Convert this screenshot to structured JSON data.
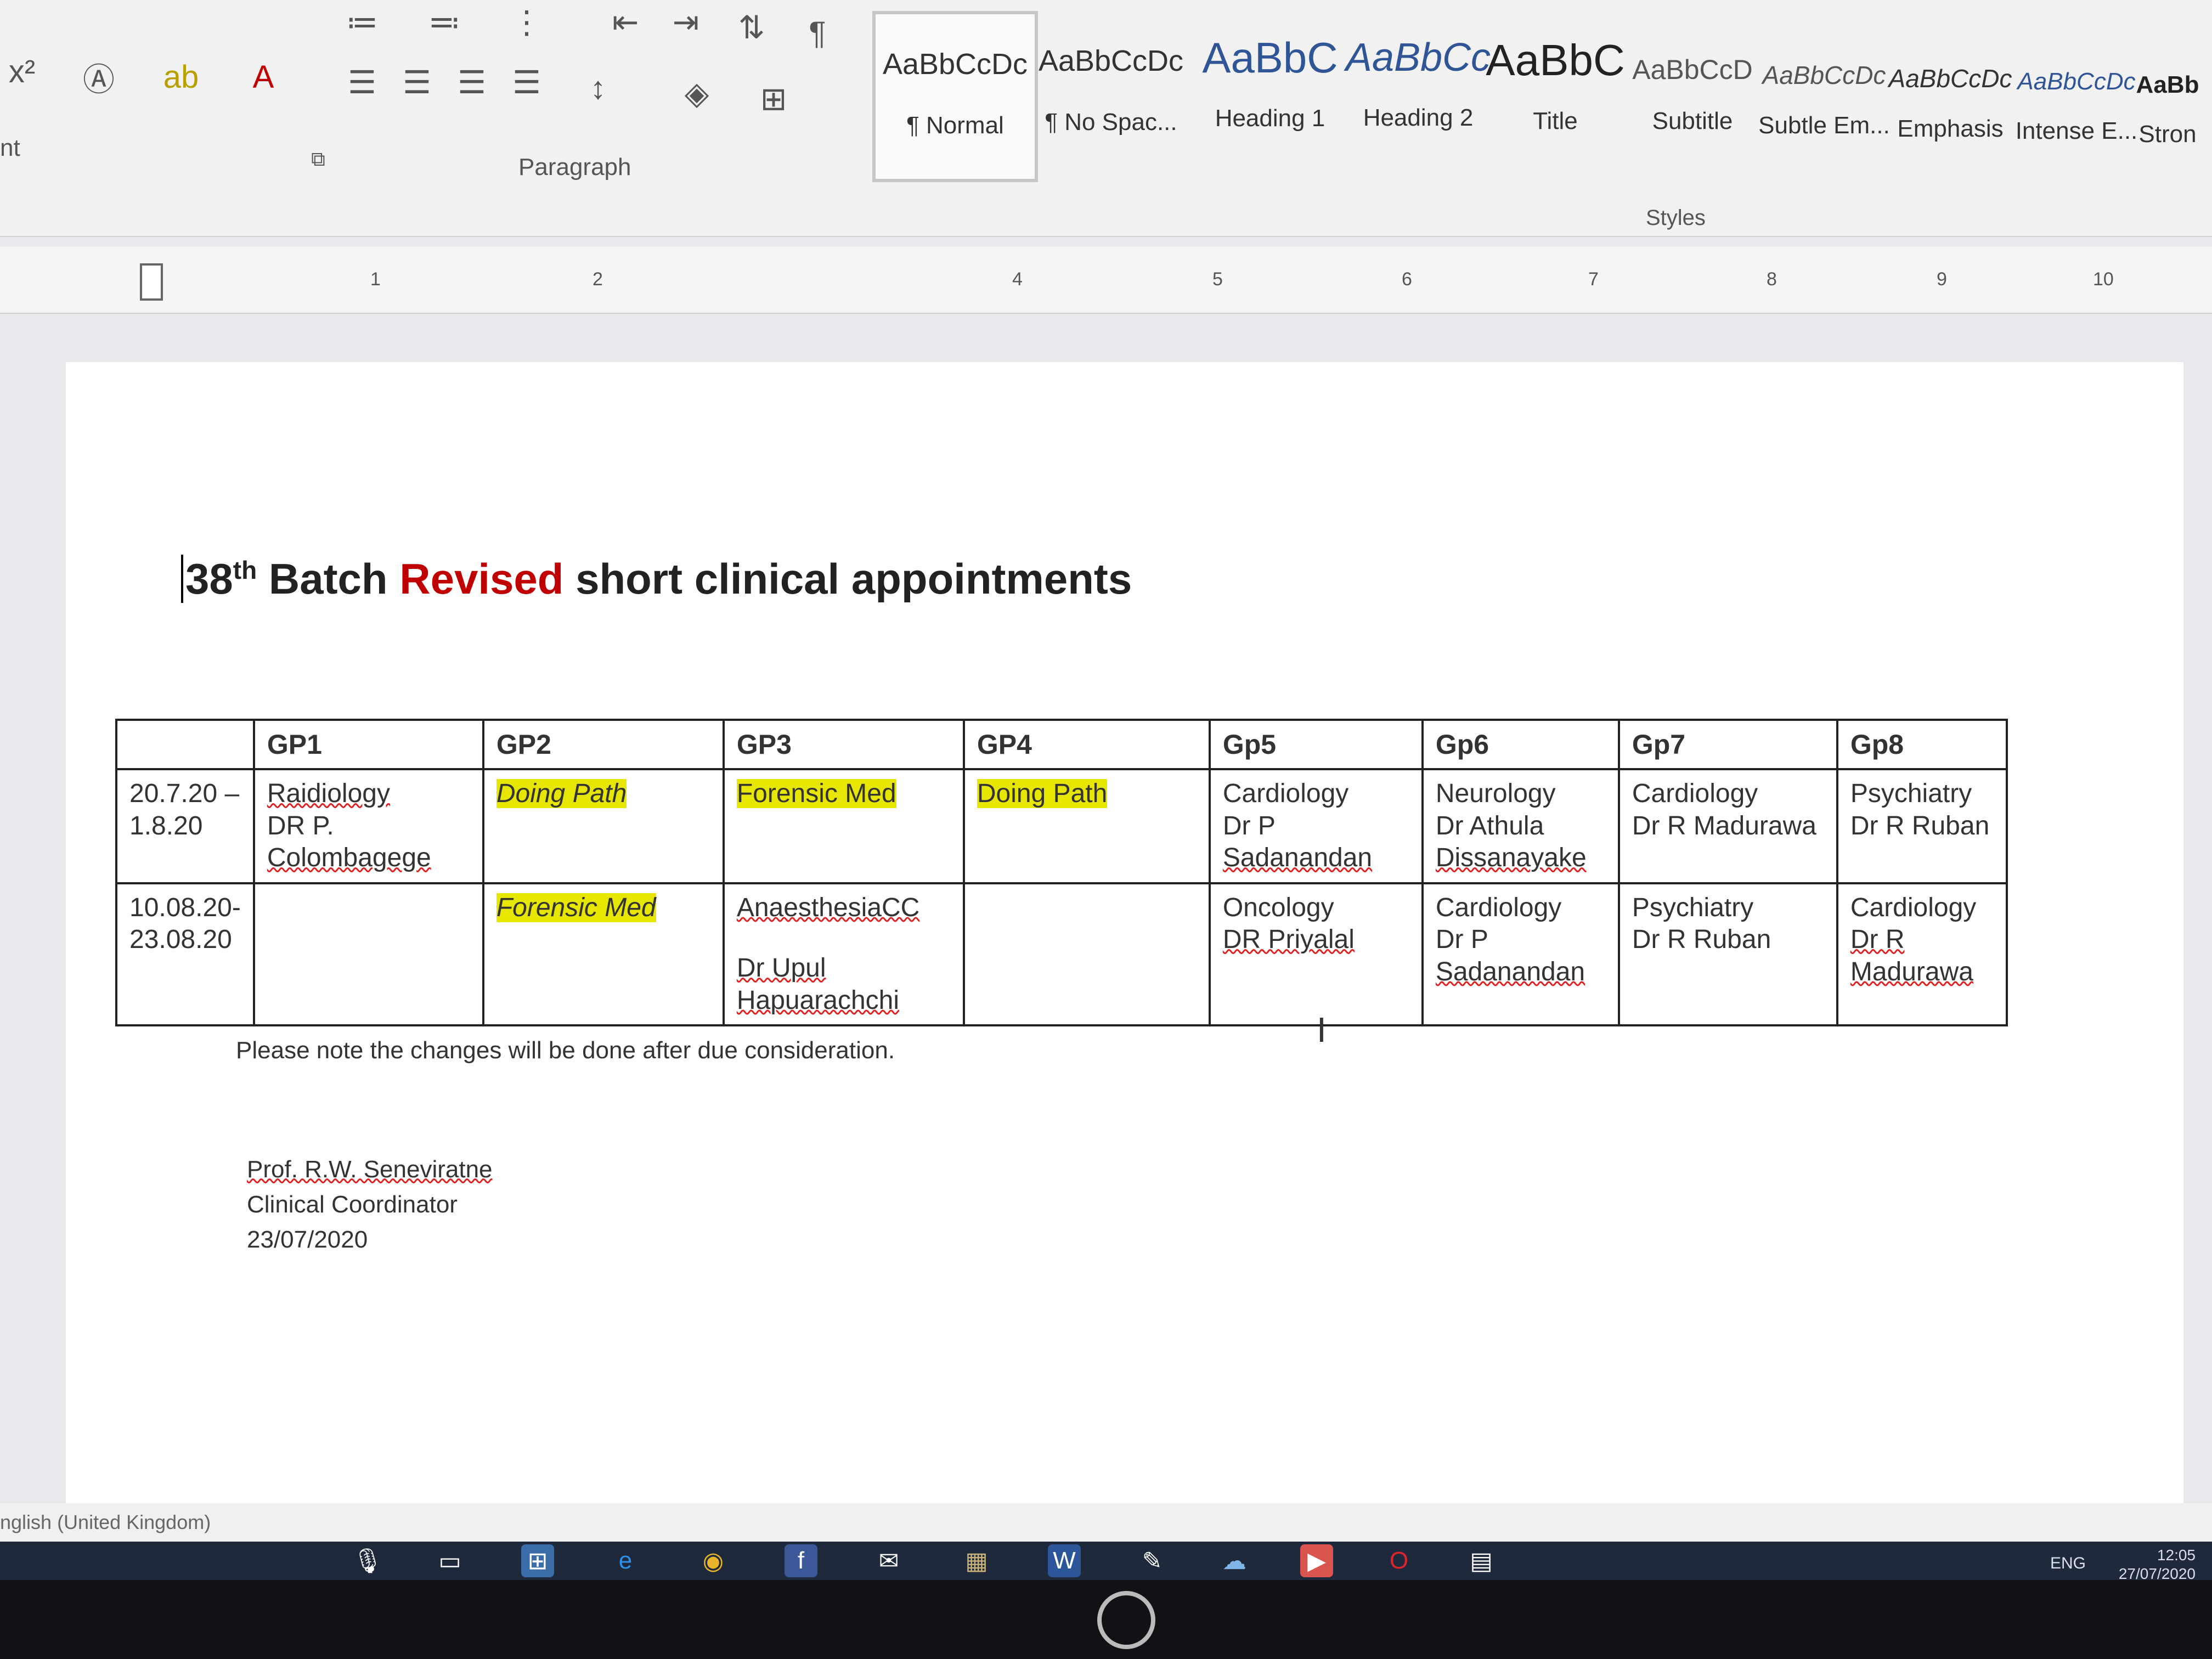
{
  "ribbon": {
    "font_group_label": "nt",
    "paragraph_group_label": "Paragraph",
    "styles_group_label": "Styles",
    "styles": [
      {
        "sample": "AaBbCcDc",
        "name": "¶ Normal"
      },
      {
        "sample": "AaBbCcDc",
        "name": "¶ No Spac..."
      },
      {
        "sample": "AaBbC",
        "name": "Heading 1"
      },
      {
        "sample": "AaBbCc",
        "name": "Heading 2"
      },
      {
        "sample": "AaBbC",
        "name": "Title"
      },
      {
        "sample": "AaBbCcD",
        "name": "Subtitle"
      },
      {
        "sample": "AaBbCcDc",
        "name": "Subtle Em..."
      },
      {
        "sample": "AaBbCcDc",
        "name": "Emphasis"
      },
      {
        "sample": "AaBbCcDc",
        "name": "Intense E..."
      },
      {
        "sample": "AaBb",
        "name": "Stron"
      }
    ],
    "icons": [
      "superscript-icon",
      "text-effects-icon",
      "highlight-icon",
      "font-color-icon",
      "align-left-icon",
      "center-icon",
      "align-right-icon",
      "justify-icon",
      "line-spacing-icon",
      "shading-icon",
      "borders-icon",
      "bullets-icon",
      "numbering-icon",
      "multilevel-list-icon",
      "decrease-indent-icon",
      "increase-indent-icon",
      "sort-icon",
      "show-marks-icon"
    ]
  },
  "ruler": {
    "numbers": [
      "1",
      "2",
      "4",
      "5",
      "6",
      "7",
      "8",
      "9",
      "10"
    ]
  },
  "document": {
    "title_prefix": "38",
    "title_sup": "th",
    "title_batch": " Batch ",
    "title_revised": "Revised",
    "title_rest": " short clinical appointments",
    "table": {
      "headers": [
        "",
        "GP1",
        "GP2",
        "GP3",
        "GP4",
        "Gp5",
        "Gp6",
        "Gp7",
        "Gp8"
      ],
      "rows": [
        {
          "date_line1": "20.7.20 –",
          "date_line2": "1.8.20",
          "gp1": {
            "line1": "Raidiology",
            "line2": "DR P.",
            "line3": "Colombagege"
          },
          "gp2": "Doing Path",
          "gp3": "Forensic Med",
          "gp4": "Doing Path",
          "gp5": {
            "line1": "Cardiology",
            "line2": "Dr P",
            "line3": "Sadanandan"
          },
          "gp6": {
            "line1": "Neurology",
            "line2": "Dr Athula",
            "line3": "Dissanayake"
          },
          "gp7": {
            "line1": "Cardiology",
            "line2": "Dr R Madurawa"
          },
          "gp8": {
            "line1": "Psychiatry",
            "line2": "Dr R Ruban"
          }
        },
        {
          "date_line1": "10.08.20-",
          "date_line2": "23.08.20",
          "gp1": "",
          "gp2": "Forensic Med",
          "gp3": {
            "line1": "AnaesthesiaCC",
            "line2": "",
            "line3": "Dr Upul",
            "line4": "Hapuarachchi"
          },
          "gp4": "",
          "gp5": {
            "line1": "Oncology",
            "line2": "DR  Priyalal"
          },
          "gp6": {
            "line1": "Cardiology",
            "line2": "Dr P",
            "line3": "Sadanandan"
          },
          "gp7": {
            "line1": "Psychiatry",
            "line2": "Dr R Ruban"
          },
          "gp8": {
            "line1": "Cardiology",
            "line2": "Dr R Madurawa"
          }
        }
      ]
    },
    "note": "Please note the changes will be done after due consideration.",
    "signature": {
      "name": "Prof. R.W. Seneviratne",
      "role": "Clinical Coordinator",
      "date": "23/07/2020"
    }
  },
  "statusbar": {
    "language": "nglish (United Kingdom)"
  },
  "taskbar": {
    "apps": [
      "cortana-mic-icon",
      "task-view-icon",
      "store-icon",
      "edge-icon",
      "chrome-icon",
      "facebook-icon",
      "mail-icon",
      "photos-icon",
      "word-icon",
      "paint-icon",
      "media-icon",
      "player-icon",
      "opera-icon",
      "calculator-icon"
    ],
    "tray_lang": "ENG",
    "time": "12:05",
    "date": "27/07/2020"
  },
  "colors": {
    "revised_red": "#c00000",
    "highlight_yellow": "#e6e600",
    "style_blue": "#2f5597"
  }
}
